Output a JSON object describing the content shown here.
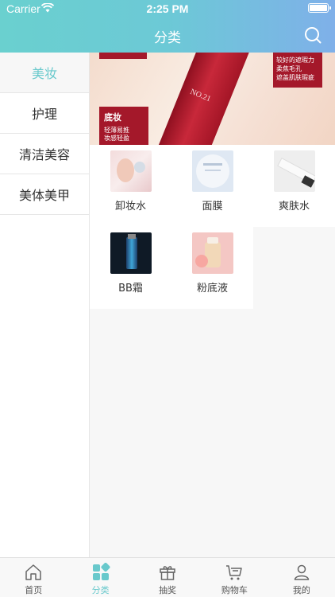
{
  "status": {
    "carrier": "Carrier",
    "time": "2:25 PM"
  },
  "header": {
    "title": "分类"
  },
  "sidebar": {
    "items": [
      {
        "label": "美妆",
        "active": true
      },
      {
        "label": "护理",
        "active": false
      },
      {
        "label": "清洁美容",
        "active": false
      },
      {
        "label": "美体美甲",
        "active": false
      }
    ]
  },
  "banner": {
    "tag_title": "底妆",
    "tag_line1": "轻薄易推",
    "tag_line2": "妆感轻盈",
    "note_line1": "较好的遮瑕力",
    "note_line2": "柔焦毛孔",
    "note_line3": "遮盖肌肤瑕疵",
    "product_text": "NO.21"
  },
  "products": [
    {
      "label": "卸妆水"
    },
    {
      "label": "面膜"
    },
    {
      "label": "爽肤水"
    },
    {
      "label": "BB霜"
    },
    {
      "label": "粉底液"
    }
  ],
  "tabbar": {
    "items": [
      {
        "label": "首页",
        "icon": "home-icon",
        "active": false
      },
      {
        "label": "分类",
        "icon": "category-icon",
        "active": true
      },
      {
        "label": "抽奖",
        "icon": "gift-icon",
        "active": false
      },
      {
        "label": "购物车",
        "icon": "cart-icon",
        "active": false
      },
      {
        "label": "我的",
        "icon": "user-icon",
        "active": false
      }
    ]
  },
  "colors": {
    "accent": "#69c9cc",
    "header_start": "#6ad0cf",
    "header_end": "#7fb0e9",
    "banner_red": "#a4182a"
  }
}
